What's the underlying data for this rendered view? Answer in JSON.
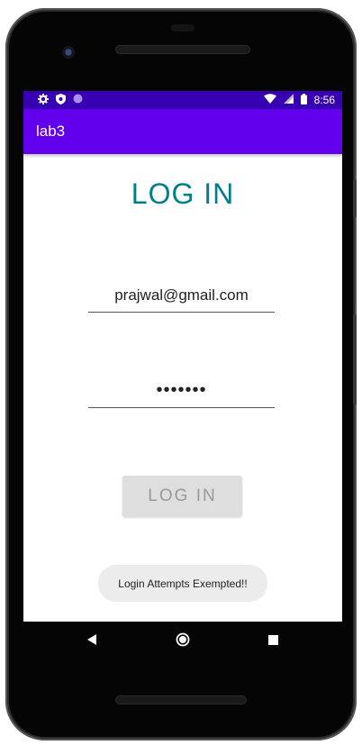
{
  "status_bar": {
    "time": "8:56",
    "icons": [
      "gear-icon",
      "shield-icon",
      "circle-icon",
      "wifi-icon",
      "signal-icon",
      "battery-icon"
    ]
  },
  "app_bar": {
    "title": "lab3"
  },
  "login": {
    "heading": "LOG IN",
    "email_value": "prajwal@gmail.com",
    "password_value": "•••••••",
    "button_label": "LOG IN"
  },
  "toast": {
    "message": "Login Attempts Exempted!!"
  },
  "nav_bar": {
    "icons": [
      "back-icon",
      "home-icon",
      "recents-icon"
    ]
  },
  "colors": {
    "status_bar": "#3700b3",
    "app_bar": "#6200ee",
    "heading": "#007f8b",
    "button_bg": "#dedede"
  }
}
